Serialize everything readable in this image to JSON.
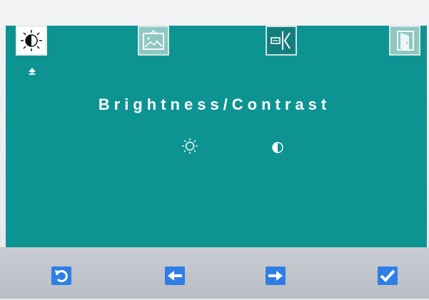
{
  "osd": {
    "title": "Brightness/Contrast",
    "tabs": [
      {
        "name": "brightness-contrast-tab",
        "icon": "brightness-icon",
        "active": true
      },
      {
        "name": "image-tab",
        "icon": "picture-icon",
        "active": false
      },
      {
        "name": "input-source-tab",
        "icon": "input-source-icon",
        "active": false
      },
      {
        "name": "exit-tab",
        "icon": "exit-door-icon",
        "active": false
      }
    ],
    "sub_items": [
      {
        "name": "brightness-option",
        "icon": "sun-icon"
      },
      {
        "name": "contrast-option",
        "icon": "contrast-icon"
      }
    ],
    "nav_buttons": [
      {
        "name": "back-button",
        "icon": "undo-arrow-icon"
      },
      {
        "name": "left-button",
        "icon": "arrow-left-icon"
      },
      {
        "name": "right-button",
        "icon": "arrow-right-icon"
      },
      {
        "name": "confirm-button",
        "icon": "checkmark-icon"
      }
    ]
  },
  "colors": {
    "panel": "#0d9492",
    "button": "#2f7ee6",
    "text": "#ffffff"
  }
}
